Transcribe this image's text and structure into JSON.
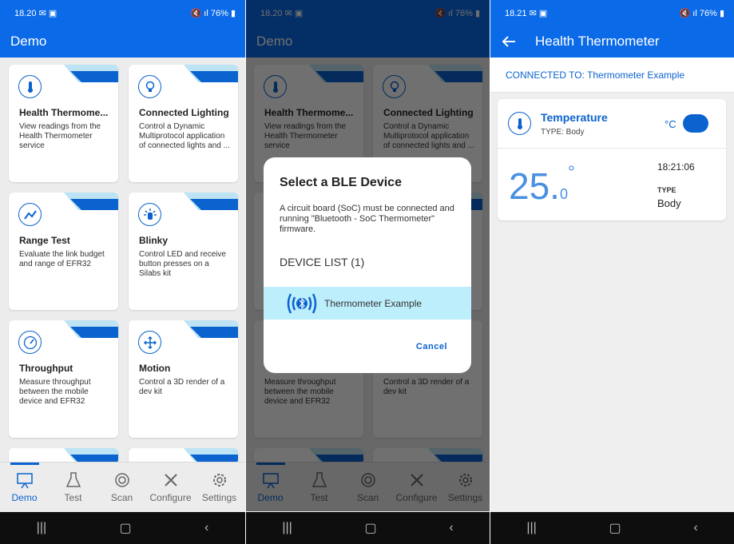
{
  "status": {
    "time_a": "18.20",
    "time_b": "18.21",
    "battery": "76%"
  },
  "app": {
    "title": "Demo"
  },
  "cards": [
    {
      "title": "Health Thermome...",
      "desc": "View readings from the Health Thermometer service",
      "icon": "thermometer-icon"
    },
    {
      "title": "Connected Lighting",
      "desc": "Control a Dynamic Multiprotocol application of connected lights and ...",
      "icon": "lightbulb-icon"
    },
    {
      "title": "Range Test",
      "desc": "Evaluate the link budget and range of EFR32",
      "icon": "range-icon"
    },
    {
      "title": "Blinky",
      "desc": "Control LED and receive button presses on a Silabs kit",
      "icon": "blinky-icon"
    },
    {
      "title": "Throughput",
      "desc": "Measure throughput between the mobile device and EFR32",
      "icon": "gauge-icon"
    },
    {
      "title": "Motion",
      "desc": "Control a 3D render of a dev kit",
      "icon": "move-icon"
    }
  ],
  "nav": [
    {
      "label": "Demo",
      "icon": "demo-icon"
    },
    {
      "label": "Test",
      "icon": "flask-icon"
    },
    {
      "label": "Scan",
      "icon": "scan-icon"
    },
    {
      "label": "Configure",
      "icon": "tools-icon"
    },
    {
      "label": "Settings",
      "icon": "gear-icon"
    }
  ],
  "dialog": {
    "title": "Select a BLE Device",
    "desc": "A circuit board (SoC) must be connected and running \"Bluetooth - SoC Thermometer\" firmware.",
    "list_label": "DEVICE LIST (1)",
    "device": "Thermometer Example",
    "cancel": "Cancel"
  },
  "thermometer": {
    "title": "Health Thermometer",
    "connected": "CONNECTED TO: Thermometer Example",
    "label": "Temperature",
    "type": "TYPE: Body",
    "unit": "°C",
    "value_int": "25.",
    "value_dec": "0",
    "degree": "°",
    "time": "18:21:06",
    "type_label": "TYPE",
    "type_value": "Body"
  },
  "colors": {
    "primary": "#0b6ae8",
    "accent": "#0b63cf",
    "highlight": "#bdeefc"
  }
}
